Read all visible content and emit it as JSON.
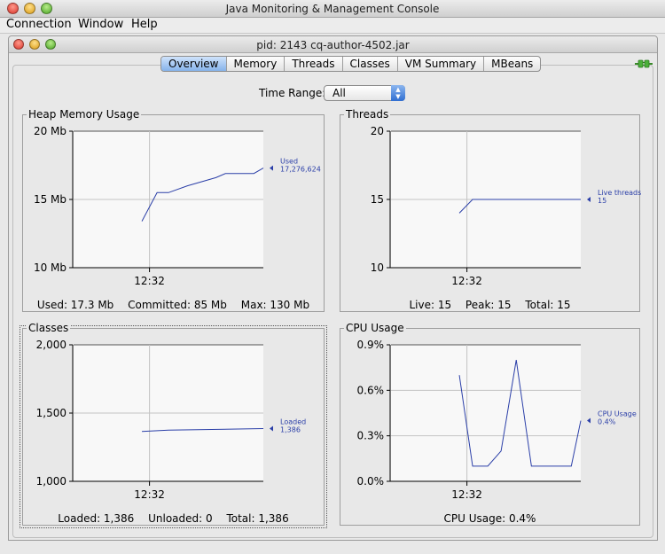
{
  "app": {
    "title": "Java Monitoring & Management Console",
    "menu": [
      "Connection",
      "Window",
      "Help"
    ]
  },
  "window": {
    "title": "pid: 2143 cq-author-4502.jar",
    "tabs": [
      "Overview",
      "Memory",
      "Threads",
      "Classes",
      "VM Summary",
      "MBeans"
    ],
    "active_tab": "Overview",
    "time_range": {
      "label": "Time Range:",
      "value": "All"
    }
  },
  "panels": {
    "heap": {
      "title": "Heap Memory Usage",
      "summary": [
        "Used: 17.3 Mb",
        "Committed: 85 Mb",
        "Max: 130 Mb"
      ],
      "marker_label": [
        "Used",
        "17,276,624"
      ]
    },
    "threads": {
      "title": "Threads",
      "summary": [
        "Live: 15",
        "Peak: 15",
        "Total: 15"
      ],
      "marker_label": [
        "Live threads",
        "15"
      ]
    },
    "classes": {
      "title": "Classes",
      "summary": [
        "Loaded: 1,386",
        "Unloaded: 0",
        "Total: 1,386"
      ],
      "marker_label": [
        "Loaded",
        "1,386"
      ]
    },
    "cpu": {
      "title": "CPU Usage",
      "summary": [
        "CPU Usage: 0.4%"
      ],
      "marker_label": [
        "CPU Usage",
        "0.4%"
      ]
    }
  },
  "colors": {
    "series": "#2b3fa8",
    "plot_bg": "#f8f8f8",
    "grid": "#c4c4c4"
  },
  "chart_data": [
    {
      "type": "line",
      "title": "Heap Memory Usage",
      "ylim": [
        10,
        20
      ],
      "y_ticks": [
        "10 Mb",
        "15 Mb",
        "20 Mb"
      ],
      "y_tick_values": [
        10,
        15,
        20
      ],
      "x_range": [
        0,
        10
      ],
      "x_ticks": [
        "12:32"
      ],
      "x_tick_values": [
        4
      ],
      "series": [
        {
          "name": "Used",
          "x": [
            3.6,
            4.4,
            5.0,
            6.0,
            7.5,
            8.0,
            9.5,
            10.0
          ],
          "y": [
            13.4,
            15.5,
            15.5,
            16.0,
            16.6,
            16.9,
            16.9,
            17.3
          ]
        }
      ]
    },
    {
      "type": "line",
      "title": "Threads",
      "ylim": [
        10,
        20
      ],
      "y_ticks": [
        "10",
        "15",
        "20"
      ],
      "y_tick_values": [
        10,
        15,
        20
      ],
      "x_range": [
        0,
        10
      ],
      "x_ticks": [
        "12:32"
      ],
      "x_tick_values": [
        4
      ],
      "series": [
        {
          "name": "Live threads",
          "x": [
            3.6,
            4.3,
            10.0
          ],
          "y": [
            14.0,
            15.0,
            15.0
          ]
        }
      ]
    },
    {
      "type": "line",
      "title": "Classes",
      "ylim": [
        1000,
        2000
      ],
      "y_ticks": [
        "1,000",
        "1,500",
        "2,000"
      ],
      "y_tick_values": [
        1000,
        1500,
        2000
      ],
      "x_range": [
        0,
        10
      ],
      "x_ticks": [
        "12:32"
      ],
      "x_tick_values": [
        4
      ],
      "series": [
        {
          "name": "Loaded",
          "x": [
            3.6,
            5.0,
            10.0
          ],
          "y": [
            1365,
            1375,
            1386
          ]
        }
      ]
    },
    {
      "type": "line",
      "title": "CPU Usage",
      "ylim": [
        0,
        0.9
      ],
      "y_ticks": [
        "0.0%",
        "0.3%",
        "0.6%",
        "0.9%"
      ],
      "y_tick_values": [
        0,
        0.3,
        0.6,
        0.9
      ],
      "x_range": [
        0,
        10
      ],
      "x_ticks": [
        "12:32"
      ],
      "x_tick_values": [
        4
      ],
      "series": [
        {
          "name": "CPU Usage",
          "x": [
            3.6,
            4.3,
            5.1,
            5.8,
            6.6,
            7.4,
            8.9,
            9.5,
            10.0
          ],
          "y": [
            0.7,
            0.1,
            0.1,
            0.2,
            0.8,
            0.1,
            0.1,
            0.1,
            0.4
          ]
        }
      ]
    }
  ]
}
